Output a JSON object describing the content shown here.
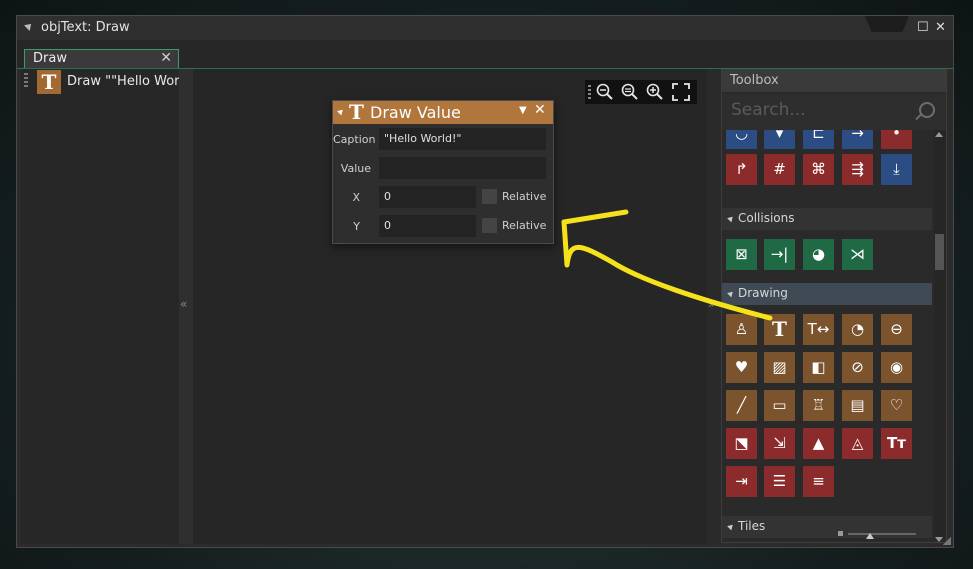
{
  "window": {
    "title": "objText: Draw"
  },
  "tab": {
    "label": "Draw",
    "close": "✕"
  },
  "actions": [
    {
      "icon": "T",
      "label": "Draw \"\"Hello World"
    }
  ],
  "splitter": {
    "left": "«",
    "right": "»"
  },
  "zoom": {
    "buttons": [
      "zoom-out-icon",
      "zoom-reset-icon",
      "zoom-in-icon",
      "fit-screen-icon"
    ]
  },
  "draw_value": {
    "icon": "T",
    "title": "Draw Value",
    "fields": {
      "caption_label": "Caption",
      "caption_value": "\"Hello World!\"",
      "value_label": "Value",
      "value_value": "",
      "x_label": "X",
      "x_value": "0",
      "x_relative": "Relative",
      "y_label": "Y",
      "y_value": "0",
      "y_relative": "Relative"
    }
  },
  "toolbox": {
    "title": "Toolbox",
    "search_placeholder": "Search...",
    "sections": {
      "collisions": "Collisions",
      "drawing": "Drawing",
      "tiles": "Tiles"
    },
    "colors": {
      "red": "#8c2b2b",
      "blue": "#2c4d83",
      "green": "#1f6a45",
      "brown": "#7b532c"
    }
  },
  "annotation": {
    "color": "#f5e21a"
  }
}
